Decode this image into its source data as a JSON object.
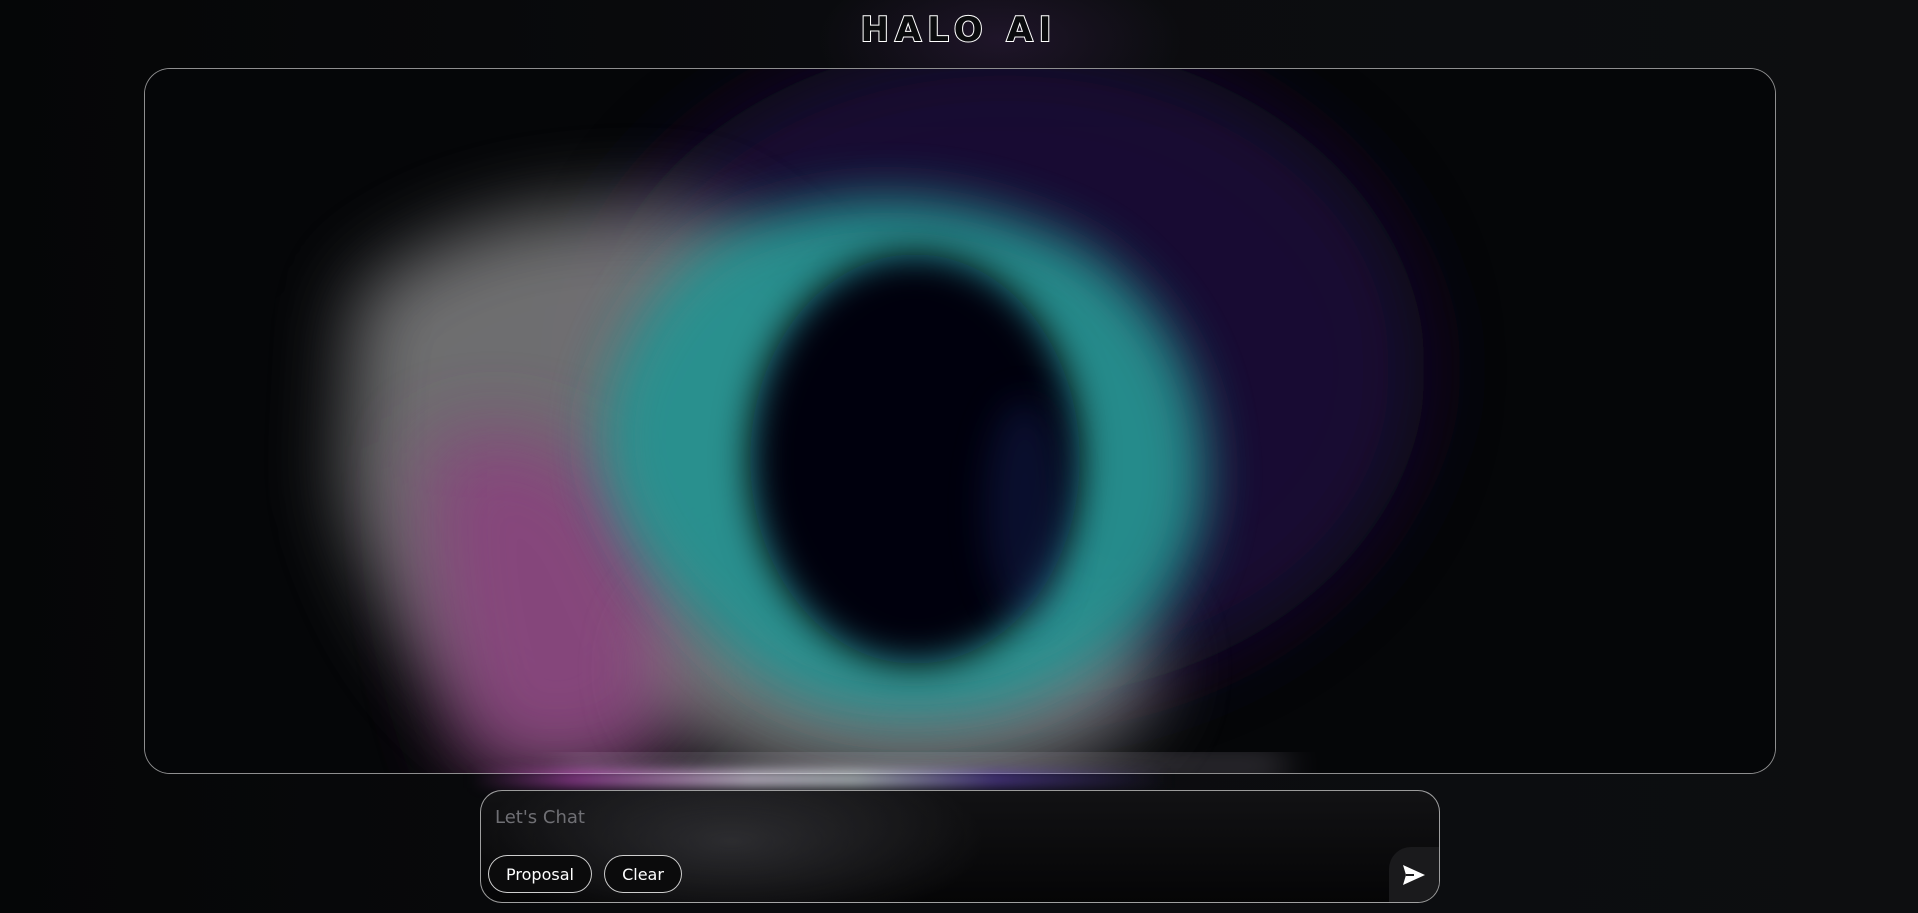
{
  "app": {
    "title": "HALO AI"
  },
  "chat": {
    "placeholder": "Let's Chat",
    "value": "",
    "buttons": {
      "proposal_label": "Proposal",
      "clear_label": "Clear"
    },
    "send_icon": "send-icon"
  },
  "visual": {
    "orb_icon": "halo-orb-visual",
    "colors": {
      "background": "#0a0b0d",
      "teal": "#2a9a96",
      "magenta": "#b0509a",
      "grey": "#8a8a8c",
      "violet": "#3a1a6a",
      "border": "#d0d0d0"
    }
  }
}
